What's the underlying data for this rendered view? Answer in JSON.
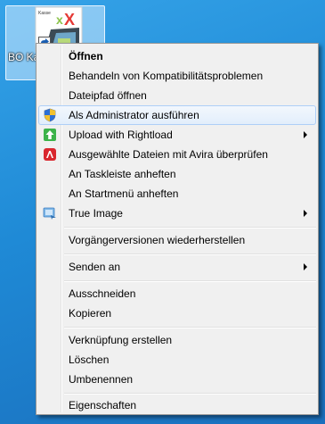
{
  "desktop": {
    "icon": {
      "label": "BO Kass",
      "logo_text": "Kasse",
      "logo_mark": "x"
    }
  },
  "context_menu": {
    "items": [
      {
        "label": "Öffnen",
        "bold": true
      },
      {
        "label": "Behandeln von Kompatibilitätsproblemen"
      },
      {
        "label": "Dateipfad öffnen"
      },
      {
        "label": "Als Administrator ausführen",
        "icon": "uac-shield-icon",
        "highlighted": true
      },
      {
        "label": "Upload with Rightload",
        "icon": "green-upload-arrow-icon",
        "submenu": true
      },
      {
        "label": "Ausgewählte Dateien mit Avira überprüfen",
        "icon": "avira-umbrella-icon"
      },
      {
        "label": "An Taskleiste anheften"
      },
      {
        "label": "An Startmenü anheften"
      },
      {
        "label": "True Image",
        "icon": "true-image-icon",
        "submenu": true
      },
      {
        "label": "Vorgängerversionen wiederherstellen"
      },
      {
        "label": "Senden an",
        "submenu": true
      },
      {
        "label": "Ausschneiden"
      },
      {
        "label": "Kopieren"
      },
      {
        "label": "Verknüpfung erstellen"
      },
      {
        "label": "Löschen"
      },
      {
        "label": "Umbenennen"
      },
      {
        "label": "Eigenschaften"
      }
    ]
  }
}
